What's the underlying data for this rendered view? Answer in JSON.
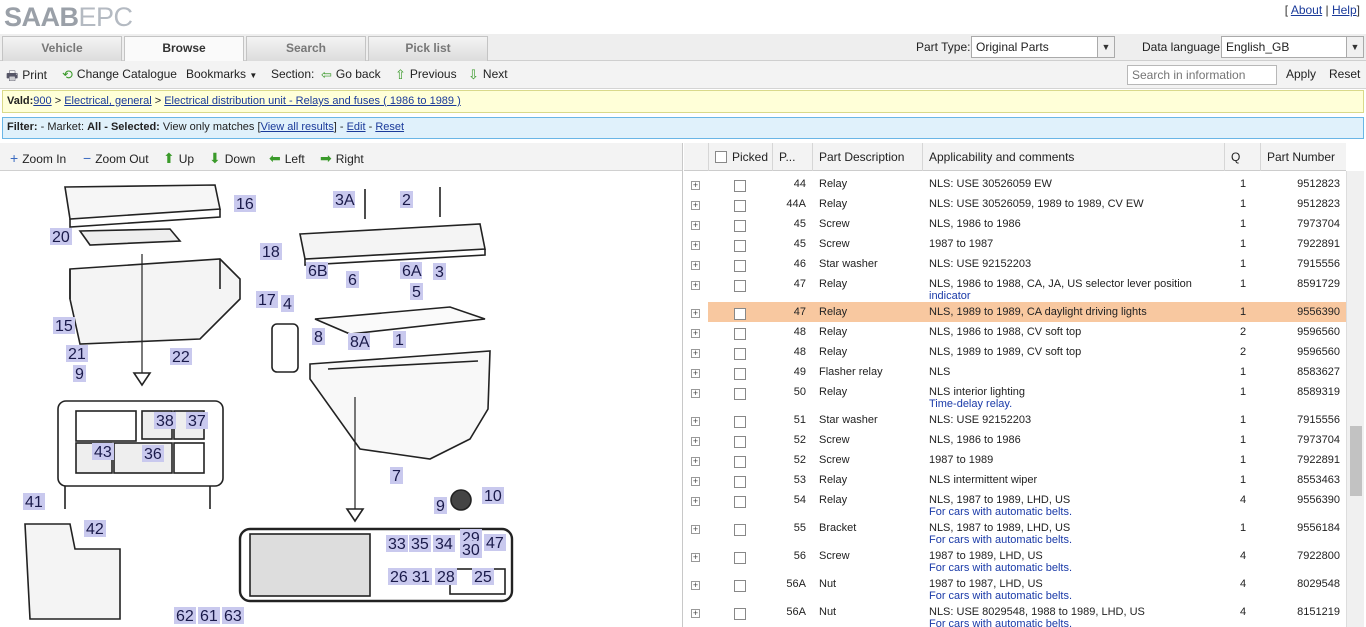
{
  "logo": {
    "saab": "SAAB",
    "epc": "EPC"
  },
  "toplinks": {
    "about": "About",
    "help": "Help"
  },
  "tabs": [
    {
      "label": "Vehicle"
    },
    {
      "label": "Browse"
    },
    {
      "label": "Search"
    },
    {
      "label": "Pick list"
    }
  ],
  "part_type": {
    "label": "Part Type:",
    "value": "Original Parts"
  },
  "data_language": {
    "label": "Data language:",
    "value": "English_GB"
  },
  "toolbar": {
    "print": "Print",
    "change_catalogue": "Change Catalogue",
    "bookmarks": "Bookmarks",
    "section": "Section:",
    "go_back": "Go back",
    "previous": "Previous",
    "next": "Next",
    "search_placeholder": "Search in information",
    "apply": "Apply",
    "reset": "Reset"
  },
  "breadcrumb": {
    "prefix": "Vald:",
    "model": "900",
    "sep": ">",
    "level1": "Electrical, general",
    "level2": "Electrical distribution unit - Relays and fuses ( 1986 to 1989 )"
  },
  "filter": {
    "label": "Filter:",
    "market_label": "- Market:",
    "market_value": "All",
    "selected_label": "- Selected:",
    "selected_value": "View only matches",
    "view_all": "View all results",
    "edit": "Edit",
    "reset": "Reset"
  },
  "zoombar": {
    "zoom_in": "Zoom In",
    "zoom_out": "Zoom Out",
    "up": "Up",
    "down": "Down",
    "left": "Left",
    "right": "Right"
  },
  "table": {
    "headers": {
      "picked": "Picked",
      "pos": "P...",
      "desc": "Part Description",
      "appl": "Applicability and comments",
      "qty": "Q",
      "partno": "Part Number"
    },
    "rows": [
      {
        "pos": "44",
        "desc": "Relay",
        "appl": "NLS: USE 30526059 EW",
        "sub": "",
        "qty": "1",
        "partno": "9512823"
      },
      {
        "pos": "44A",
        "desc": "Relay",
        "appl": "NLS: USE 30526059, 1989 to 1989, CV EW",
        "sub": "",
        "qty": "1",
        "partno": "9512823"
      },
      {
        "pos": "45",
        "desc": "Screw",
        "appl": "NLS, 1986 to 1986",
        "sub": "",
        "qty": "1",
        "partno": "7973704"
      },
      {
        "pos": "45",
        "desc": "Screw",
        "appl": "1987 to 1987",
        "sub": "",
        "qty": "1",
        "partno": "7922891"
      },
      {
        "pos": "46",
        "desc": "Star washer",
        "appl": "NLS: USE 92152203",
        "sub": "",
        "qty": "1",
        "partno": "7915556"
      },
      {
        "pos": "47",
        "desc": "Relay",
        "appl": "NLS, 1986 to 1988, CA, JA, US selector lever position",
        "sub": "indicator",
        "qty": "1",
        "partno": "8591729"
      },
      {
        "pos": "47",
        "desc": "Relay",
        "appl": "NLS, 1989 to 1989, CA daylight driving lights",
        "sub": "",
        "qty": "1",
        "partno": "9556390",
        "highlight": true
      },
      {
        "pos": "48",
        "desc": "Relay",
        "appl": "NLS, 1986 to 1988, CV soft top",
        "sub": "",
        "qty": "2",
        "partno": "9596560"
      },
      {
        "pos": "48",
        "desc": "Relay",
        "appl": "NLS, 1989 to 1989, CV soft top",
        "sub": "",
        "qty": "2",
        "partno": "9596560"
      },
      {
        "pos": "49",
        "desc": "Flasher relay",
        "appl": "NLS",
        "sub": "",
        "qty": "1",
        "partno": "8583627"
      },
      {
        "pos": "50",
        "desc": "Relay",
        "appl": "NLS interior lighting",
        "sub": "Time-delay relay.",
        "qty": "1",
        "partno": "8589319"
      },
      {
        "pos": "51",
        "desc": "Star washer",
        "appl": "NLS: USE 92152203",
        "sub": "",
        "qty": "1",
        "partno": "7915556"
      },
      {
        "pos": "52",
        "desc": "Screw",
        "appl": "NLS, 1986 to 1986",
        "sub": "",
        "qty": "1",
        "partno": "7973704"
      },
      {
        "pos": "52",
        "desc": "Screw",
        "appl": "1987 to 1989",
        "sub": "",
        "qty": "1",
        "partno": "7922891"
      },
      {
        "pos": "53",
        "desc": "Relay",
        "appl": "NLS intermittent wiper",
        "sub": "",
        "qty": "1",
        "partno": "8553463"
      },
      {
        "pos": "54",
        "desc": "Relay",
        "appl": "NLS, 1987 to 1989, LHD, US",
        "sub": "For cars with automatic belts.",
        "qty": "4",
        "partno": "9556390"
      },
      {
        "pos": "55",
        "desc": "Bracket",
        "appl": "NLS, 1987 to 1989, LHD, US",
        "sub": "For cars with automatic belts.",
        "qty": "1",
        "partno": "9556184"
      },
      {
        "pos": "56",
        "desc": "Screw",
        "appl": "1987 to 1989, LHD, US",
        "sub": "For cars with automatic belts.",
        "qty": "4",
        "partno": "7922800"
      },
      {
        "pos": "56A",
        "desc": "Nut",
        "appl": "1987 to 1987, LHD, US",
        "sub": "For cars with automatic belts.",
        "qty": "4",
        "partno": "8029548"
      },
      {
        "pos": "56A",
        "desc": "Nut",
        "appl": "NLS: USE 8029548, 1988 to 1989, LHD, US",
        "sub": "For cars with automatic belts.",
        "qty": "4",
        "partno": "8151219"
      }
    ]
  },
  "diagram_labels": [
    "16",
    "20",
    "18",
    "17",
    "15",
    "21",
    "22",
    "9",
    "38",
    "37",
    "43",
    "36",
    "41",
    "42",
    "3A",
    "2",
    "6B",
    "6",
    "6A",
    "5",
    "3",
    "4",
    "8",
    "8A",
    "1",
    "7",
    "9",
    "10",
    "33",
    "35",
    "34",
    "29",
    "30",
    "47",
    "26",
    "31",
    "28",
    "25",
    "62",
    "61",
    "63"
  ]
}
